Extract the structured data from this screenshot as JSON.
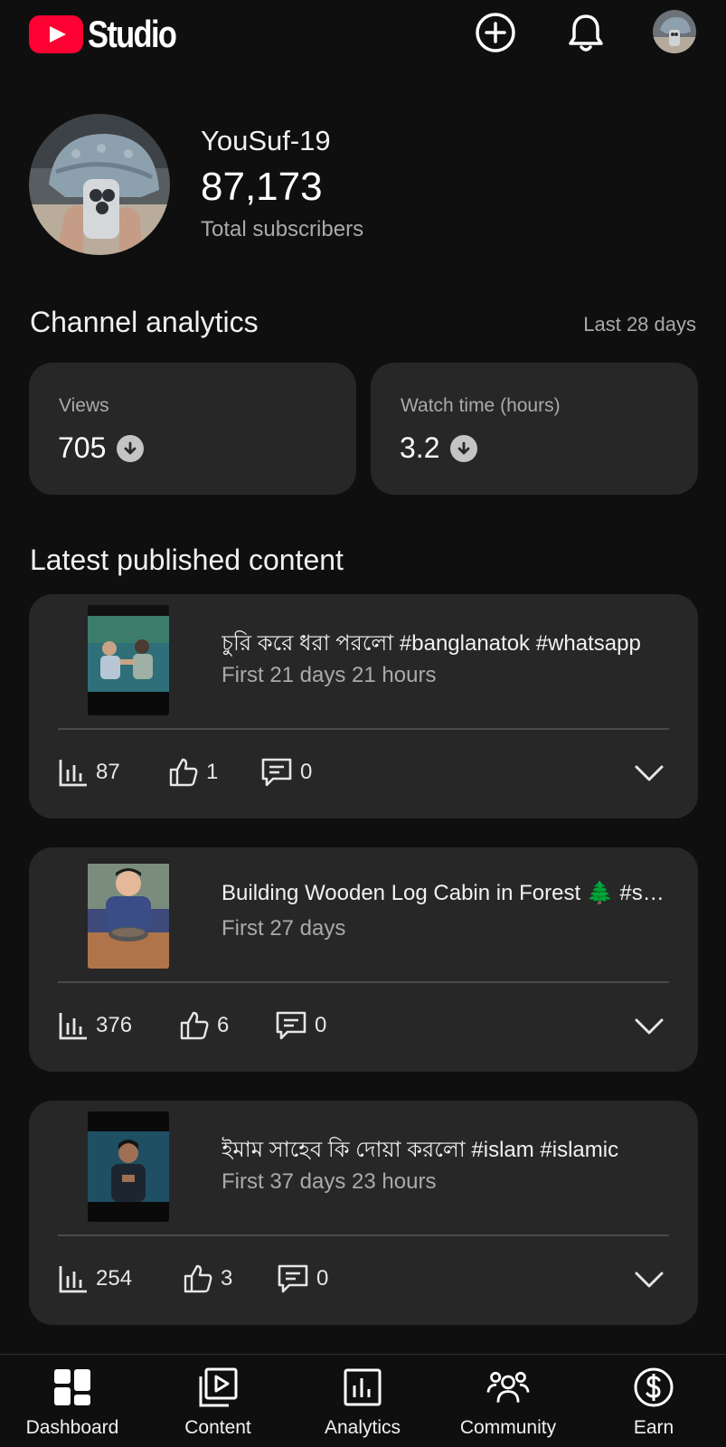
{
  "header": {
    "logo_text": "Studio",
    "icons": [
      "create-icon",
      "bell-icon",
      "account-avatar"
    ]
  },
  "profile": {
    "channel_name": "YouSuf-19",
    "subscriber_count": "87,173",
    "subscriber_label": "Total subscribers"
  },
  "analytics": {
    "title": "Channel analytics",
    "range": "Last 28 days",
    "metrics": [
      {
        "label": "Views",
        "value": "705",
        "trend": "down"
      },
      {
        "label": "Watch time (hours)",
        "value": "3.2",
        "trend": "down"
      }
    ]
  },
  "latest": {
    "title": "Latest published content",
    "items": [
      {
        "title": "চুরি করে ধরা পরলো #banglanatok #whatsapp",
        "time": "First 21 days 21 hours",
        "views": "87",
        "likes": "1",
        "comments": "0"
      },
      {
        "title": "Building Wooden Log Cabin in Forest 🌲 #shorts",
        "time": "First 27 days",
        "views": "376",
        "likes": "6",
        "comments": "0"
      },
      {
        "title": "ইমাম সাহেব কি দোয়া করলো #islam #islamic",
        "time": "First 37 days 23 hours",
        "views": "254",
        "likes": "3",
        "comments": "0"
      }
    ]
  },
  "nav": {
    "items": [
      {
        "label": "Dashboard",
        "icon": "dashboard-icon"
      },
      {
        "label": "Content",
        "icon": "content-icon"
      },
      {
        "label": "Analytics",
        "icon": "analytics-icon"
      },
      {
        "label": "Community",
        "icon": "community-icon"
      },
      {
        "label": "Earn",
        "icon": "earn-icon"
      }
    ]
  },
  "colors": {
    "background": "#0f0f0f",
    "card": "#272727",
    "brand_red": "#ff0033",
    "secondary_text": "#aaaaaa"
  }
}
